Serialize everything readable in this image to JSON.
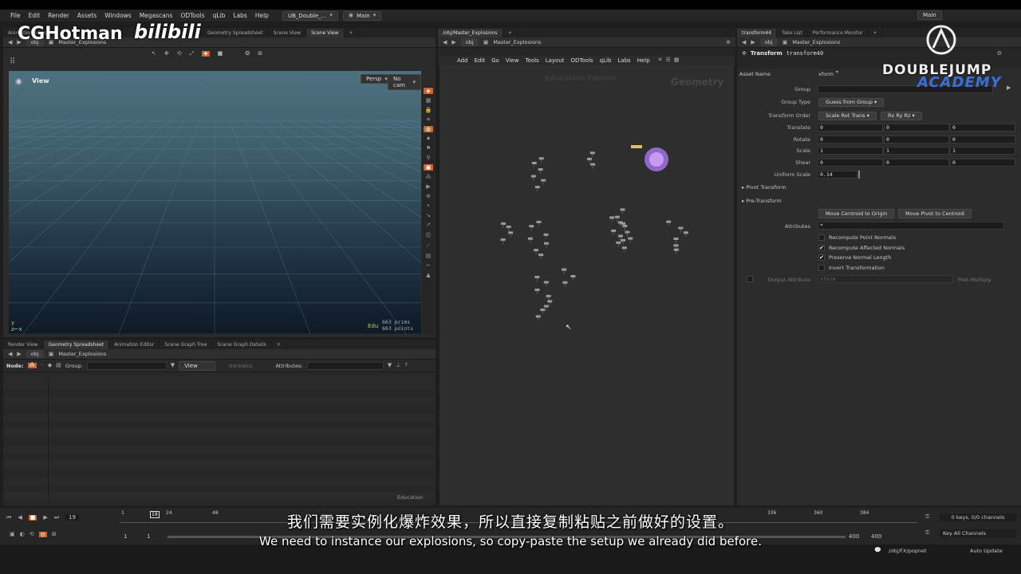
{
  "menubar": {
    "items": [
      "File",
      "Edit",
      "Render",
      "Assets",
      "Windows",
      "Megascans",
      "ODTools",
      "qLib",
      "Labs",
      "Help"
    ],
    "desktop": "UB_Double_...",
    "context": "Main",
    "right_context": "Main"
  },
  "top_left_panel": {
    "tabs": [
      "Animation Editor",
      "Geometry Spreadsheet",
      "Scene View",
      "Scene View"
    ],
    "path": {
      "level": "obj",
      "node": "Master_Explosions"
    },
    "view_label": "View",
    "camera_menu": "Persp",
    "cam_menu": "No cam",
    "hud_label": "Edu",
    "prims": "663  prims",
    "points": "663  points"
  },
  "bottom_left_panel": {
    "tabs": [
      "Render View",
      "Geometry Spreadsheet",
      "Animation Editor",
      "Scene Graph Tree",
      "Scene Graph Details"
    ],
    "path": {
      "level": "obj",
      "node": "Master_Explosions"
    },
    "node_label": "Node:",
    "group_label": "Group:",
    "view_menu": "View",
    "intrinsics": "Intrinsics",
    "attributes_label": "Attributes:",
    "edition": "Education"
  },
  "network_panel": {
    "tab": "/obj/Master_Explosions",
    "path": {
      "level": "obj",
      "node": "Master_Explosions"
    },
    "menu": [
      "Add",
      "Edit",
      "Go",
      "View",
      "Tools",
      "Layout",
      "ODTools",
      "qLib",
      "Labs",
      "Help"
    ],
    "watermark_edition": "Education Edition",
    "watermark_context": "Geometry"
  },
  "params_panel": {
    "tabs": [
      "transform44",
      "Take List",
      "Performance Monitor"
    ],
    "path": {
      "level": "obj",
      "node": "Master_Explosions"
    },
    "node_type": "Transform",
    "node_name": "transform40",
    "asset_name_label": "Asset Name",
    "asset_name_value": "xform",
    "group_label": "Group",
    "group_type_label": "Group Type",
    "group_type_value": "Guess from Group",
    "transform_order_label": "Transform Order",
    "transform_order_value": "Scale Rot Trans",
    "rotate_order_value": "Rx Ry Rz",
    "translate_label": "Translate",
    "translate": [
      "0",
      "0",
      "0"
    ],
    "rotate_label": "Rotate",
    "rotate": [
      "0",
      "0",
      "0"
    ],
    "scale_label": "Scale",
    "scale": [
      "1",
      "1",
      "1"
    ],
    "shear_label": "Shear",
    "shear": [
      "0",
      "0",
      "0"
    ],
    "uniform_scale_label": "Uniform Scale",
    "uniform_scale": "0.14",
    "pivot_transform": "Pivot Transform",
    "pre_transform": "Pre-Transform",
    "move_centroid_origin": "Move Centroid to Origin",
    "move_pivot_centroid": "Move Pivot to Centroid",
    "attributes_label": "Attributes",
    "attributes_value": "*",
    "recompute_point_normals": "Recompute Point Normals",
    "recompute_affected_normals": "Recompute Affected Normals",
    "preserve_normal_length": "Preserve Normal Length",
    "invert_transformation": "Invert Transformation",
    "output_attribute_label": "Output Attribute",
    "output_attribute_value": "xform",
    "post_multiply": "Post-Multiply"
  },
  "timeline": {
    "current_frame": "19",
    "frame_marker": "19",
    "ticks": [
      "1",
      "24",
      "48",
      "336",
      "360",
      "384"
    ],
    "start": "1",
    "start2": "1",
    "end": "400",
    "end2": "400",
    "keys_info": "0 keys, 0/0 channels",
    "key_all_channels": "Key All Channels",
    "status_path": "/obj/FX/popnet",
    "auto_update": "Auto Update"
  },
  "overlay": {
    "logo_left": "CGHotman",
    "logo_bili": "bilibili",
    "logo_right": "DOUBLEJUMP",
    "logo_right2": "ACADEMY",
    "subtitle_cn": "我们需要实例化爆炸效果，所以直接复制粘贴之前做好的设置。",
    "subtitle_en": "We need to instance our explosions, so copy-paste the setup we already did before."
  },
  "colors": {
    "accent_orange": "#c8662c",
    "viewport_top": "#4e7180",
    "viewport_bottom": "#0f1a27",
    "node_purple": "#9b6fd9"
  }
}
